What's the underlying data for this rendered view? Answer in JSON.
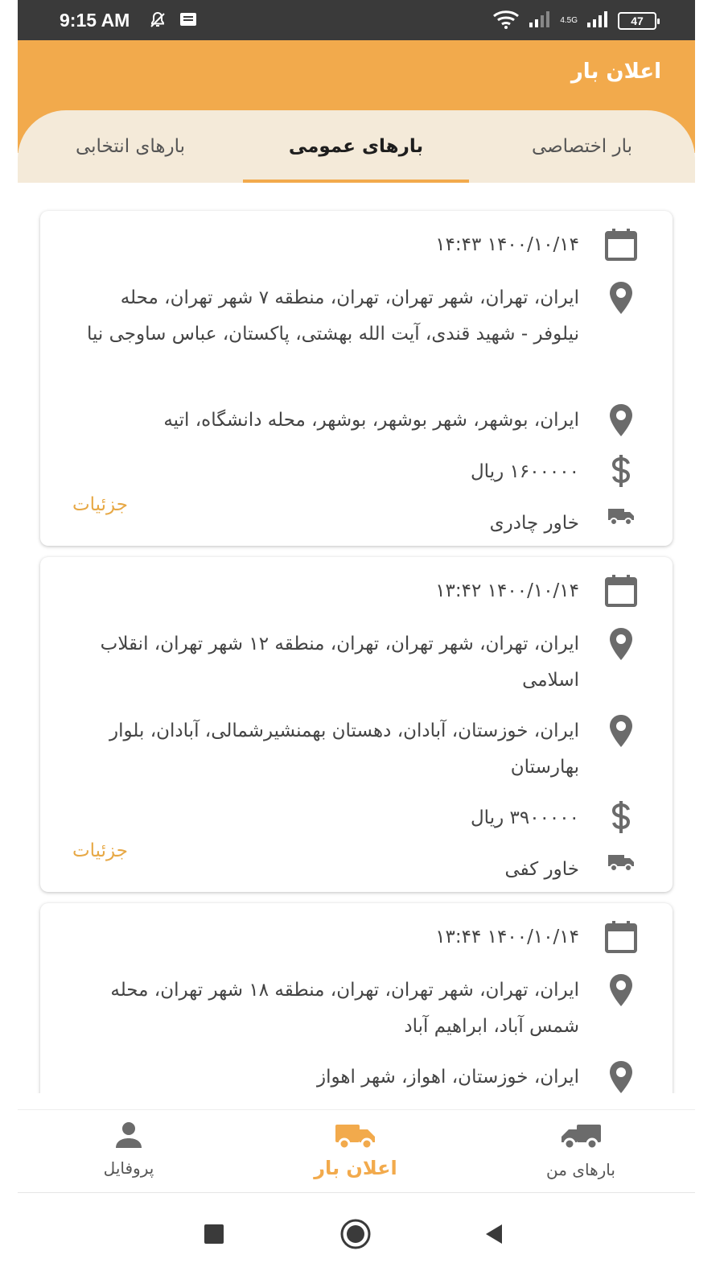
{
  "status_bar": {
    "time": "9:15 AM",
    "network_label": "4.5G",
    "battery": "47"
  },
  "header": {
    "title": "اعلان بار"
  },
  "tabs": [
    {
      "label": "بارهای انتخابی",
      "active": false
    },
    {
      "label": "بارهای عمومی",
      "active": true
    },
    {
      "label": "بار اختصاصی",
      "active": false
    }
  ],
  "cards": [
    {
      "datetime": "۱۴۰۰/۱۰/۱۴   ۱۴:۴۳",
      "origin": "ایران، تهران، شهر تهران، تهران، منطقه ۷ شهر تهران، محله نیلوفر - شهید قندی، آیت الله بهشتی، پاکستان، عباس ساوجی نیا",
      "destination": "ایران، بوشهر، شهر بوشهر، بوشهر، محله دانشگاه، اتیه",
      "price": "۱۶۰۰۰۰۰ ریال",
      "vehicle": "خاور  چادری",
      "details_label": "جزئیات"
    },
    {
      "datetime": "۱۴۰۰/۱۰/۱۴   ۱۳:۴۲",
      "origin": "ایران، تهران، شهر تهران، تهران، منطقه ۱۲ شهر تهران، انقلاب اسلامی",
      "destination": "ایران، خوزستان، آبادان، دهستان بهمنشیرشمالی، آبادان، بلوار بهارستان",
      "price": "۳۹۰۰۰۰۰ ریال",
      "vehicle": "خاور  کفی",
      "details_label": "جزئیات"
    },
    {
      "datetime": "۱۴۰۰/۱۰/۱۴   ۱۳:۴۴",
      "origin": "ایران، تهران، شهر تهران، تهران، منطقه ۱۸ شهر تهران، محله شمس آباد، ابراهیم آباد",
      "destination": "ایران، خوزستان، اهواز، شهر اهواز"
    }
  ],
  "bottom_nav": [
    {
      "label": "پروفایل",
      "icon": "person-icon",
      "active": false
    },
    {
      "label": "اعلان بار",
      "icon": "truck-icon",
      "active": true
    },
    {
      "label": "بارهای من",
      "icon": "truck-icon",
      "active": false
    }
  ],
  "colors": {
    "accent": "#f2aa4c",
    "tab_background": "#f4ead9",
    "status_bar": "#3a3a3a",
    "icon_gray": "#6b6b6b"
  }
}
